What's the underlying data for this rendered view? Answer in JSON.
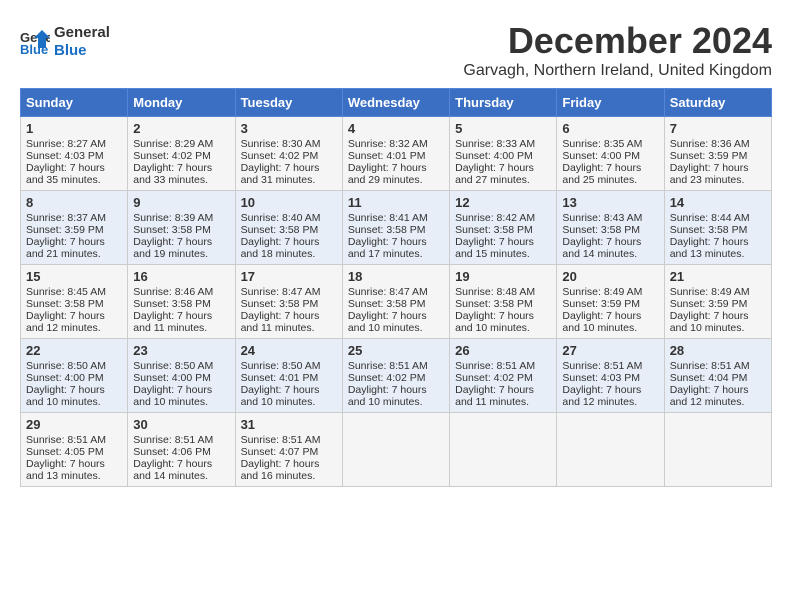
{
  "header": {
    "logo_line1": "General",
    "logo_line2": "Blue",
    "month_year": "December 2024",
    "location": "Garvagh, Northern Ireland, United Kingdom"
  },
  "weekdays": [
    "Sunday",
    "Monday",
    "Tuesday",
    "Wednesday",
    "Thursday",
    "Friday",
    "Saturday"
  ],
  "weeks": [
    [
      {
        "day": "1",
        "lines": [
          "Sunrise: 8:27 AM",
          "Sunset: 4:03 PM",
          "Daylight: 7 hours",
          "and 35 minutes."
        ]
      },
      {
        "day": "2",
        "lines": [
          "Sunrise: 8:29 AM",
          "Sunset: 4:02 PM",
          "Daylight: 7 hours",
          "and 33 minutes."
        ]
      },
      {
        "day": "3",
        "lines": [
          "Sunrise: 8:30 AM",
          "Sunset: 4:02 PM",
          "Daylight: 7 hours",
          "and 31 minutes."
        ]
      },
      {
        "day": "4",
        "lines": [
          "Sunrise: 8:32 AM",
          "Sunset: 4:01 PM",
          "Daylight: 7 hours",
          "and 29 minutes."
        ]
      },
      {
        "day": "5",
        "lines": [
          "Sunrise: 8:33 AM",
          "Sunset: 4:00 PM",
          "Daylight: 7 hours",
          "and 27 minutes."
        ]
      },
      {
        "day": "6",
        "lines": [
          "Sunrise: 8:35 AM",
          "Sunset: 4:00 PM",
          "Daylight: 7 hours",
          "and 25 minutes."
        ]
      },
      {
        "day": "7",
        "lines": [
          "Sunrise: 8:36 AM",
          "Sunset: 3:59 PM",
          "Daylight: 7 hours",
          "and 23 minutes."
        ]
      }
    ],
    [
      {
        "day": "8",
        "lines": [
          "Sunrise: 8:37 AM",
          "Sunset: 3:59 PM",
          "Daylight: 7 hours",
          "and 21 minutes."
        ]
      },
      {
        "day": "9",
        "lines": [
          "Sunrise: 8:39 AM",
          "Sunset: 3:58 PM",
          "Daylight: 7 hours",
          "and 19 minutes."
        ]
      },
      {
        "day": "10",
        "lines": [
          "Sunrise: 8:40 AM",
          "Sunset: 3:58 PM",
          "Daylight: 7 hours",
          "and 18 minutes."
        ]
      },
      {
        "day": "11",
        "lines": [
          "Sunrise: 8:41 AM",
          "Sunset: 3:58 PM",
          "Daylight: 7 hours",
          "and 17 minutes."
        ]
      },
      {
        "day": "12",
        "lines": [
          "Sunrise: 8:42 AM",
          "Sunset: 3:58 PM",
          "Daylight: 7 hours",
          "and 15 minutes."
        ]
      },
      {
        "day": "13",
        "lines": [
          "Sunrise: 8:43 AM",
          "Sunset: 3:58 PM",
          "Daylight: 7 hours",
          "and 14 minutes."
        ]
      },
      {
        "day": "14",
        "lines": [
          "Sunrise: 8:44 AM",
          "Sunset: 3:58 PM",
          "Daylight: 7 hours",
          "and 13 minutes."
        ]
      }
    ],
    [
      {
        "day": "15",
        "lines": [
          "Sunrise: 8:45 AM",
          "Sunset: 3:58 PM",
          "Daylight: 7 hours",
          "and 12 minutes."
        ]
      },
      {
        "day": "16",
        "lines": [
          "Sunrise: 8:46 AM",
          "Sunset: 3:58 PM",
          "Daylight: 7 hours",
          "and 11 minutes."
        ]
      },
      {
        "day": "17",
        "lines": [
          "Sunrise: 8:47 AM",
          "Sunset: 3:58 PM",
          "Daylight: 7 hours",
          "and 11 minutes."
        ]
      },
      {
        "day": "18",
        "lines": [
          "Sunrise: 8:47 AM",
          "Sunset: 3:58 PM",
          "Daylight: 7 hours",
          "and 10 minutes."
        ]
      },
      {
        "day": "19",
        "lines": [
          "Sunrise: 8:48 AM",
          "Sunset: 3:58 PM",
          "Daylight: 7 hours",
          "and 10 minutes."
        ]
      },
      {
        "day": "20",
        "lines": [
          "Sunrise: 8:49 AM",
          "Sunset: 3:59 PM",
          "Daylight: 7 hours",
          "and 10 minutes."
        ]
      },
      {
        "day": "21",
        "lines": [
          "Sunrise: 8:49 AM",
          "Sunset: 3:59 PM",
          "Daylight: 7 hours",
          "and 10 minutes."
        ]
      }
    ],
    [
      {
        "day": "22",
        "lines": [
          "Sunrise: 8:50 AM",
          "Sunset: 4:00 PM",
          "Daylight: 7 hours",
          "and 10 minutes."
        ]
      },
      {
        "day": "23",
        "lines": [
          "Sunrise: 8:50 AM",
          "Sunset: 4:00 PM",
          "Daylight: 7 hours",
          "and 10 minutes."
        ]
      },
      {
        "day": "24",
        "lines": [
          "Sunrise: 8:50 AM",
          "Sunset: 4:01 PM",
          "Daylight: 7 hours",
          "and 10 minutes."
        ]
      },
      {
        "day": "25",
        "lines": [
          "Sunrise: 8:51 AM",
          "Sunset: 4:02 PM",
          "Daylight: 7 hours",
          "and 10 minutes."
        ]
      },
      {
        "day": "26",
        "lines": [
          "Sunrise: 8:51 AM",
          "Sunset: 4:02 PM",
          "Daylight: 7 hours",
          "and 11 minutes."
        ]
      },
      {
        "day": "27",
        "lines": [
          "Sunrise: 8:51 AM",
          "Sunset: 4:03 PM",
          "Daylight: 7 hours",
          "and 12 minutes."
        ]
      },
      {
        "day": "28",
        "lines": [
          "Sunrise: 8:51 AM",
          "Sunset: 4:04 PM",
          "Daylight: 7 hours",
          "and 12 minutes."
        ]
      }
    ],
    [
      {
        "day": "29",
        "lines": [
          "Sunrise: 8:51 AM",
          "Sunset: 4:05 PM",
          "Daylight: 7 hours",
          "and 13 minutes."
        ]
      },
      {
        "day": "30",
        "lines": [
          "Sunrise: 8:51 AM",
          "Sunset: 4:06 PM",
          "Daylight: 7 hours",
          "and 14 minutes."
        ]
      },
      {
        "day": "31",
        "lines": [
          "Sunrise: 8:51 AM",
          "Sunset: 4:07 PM",
          "Daylight: 7 hours",
          "and 16 minutes."
        ]
      },
      null,
      null,
      null,
      null
    ]
  ]
}
